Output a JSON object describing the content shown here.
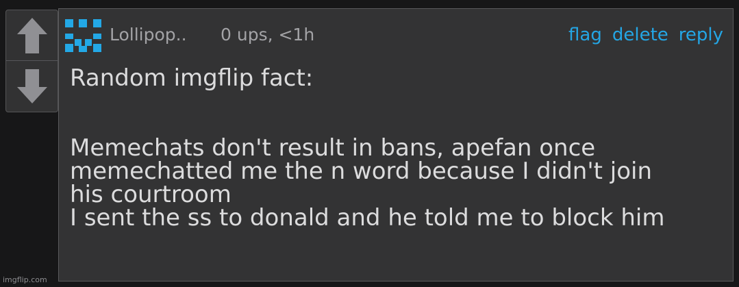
{
  "comment": {
    "username": "Lollipop..",
    "meta": "0 ups, <1h",
    "actions": {
      "flag": "flag",
      "delete": "delete",
      "reply": "reply"
    },
    "text_lines": [
      "Random imgflip fact:",
      "",
      "",
      "Memechats don't result in bans, apefan once",
      "memechatted me the n word because I didn't join",
      "his courtroom",
      "I sent the ss to donald and he told me to block him"
    ]
  },
  "votes": {
    "up_icon": "arrow-up-icon",
    "down_icon": "arrow-down-icon"
  },
  "watermark": "imgflip.com",
  "colors": {
    "background": "#171718",
    "card": "#333334",
    "text": "#dcdcdd",
    "muted_text": "#a3a3a6",
    "link": "#24a6e5",
    "avatar": "#23a8e6",
    "arrow": "#909094"
  }
}
